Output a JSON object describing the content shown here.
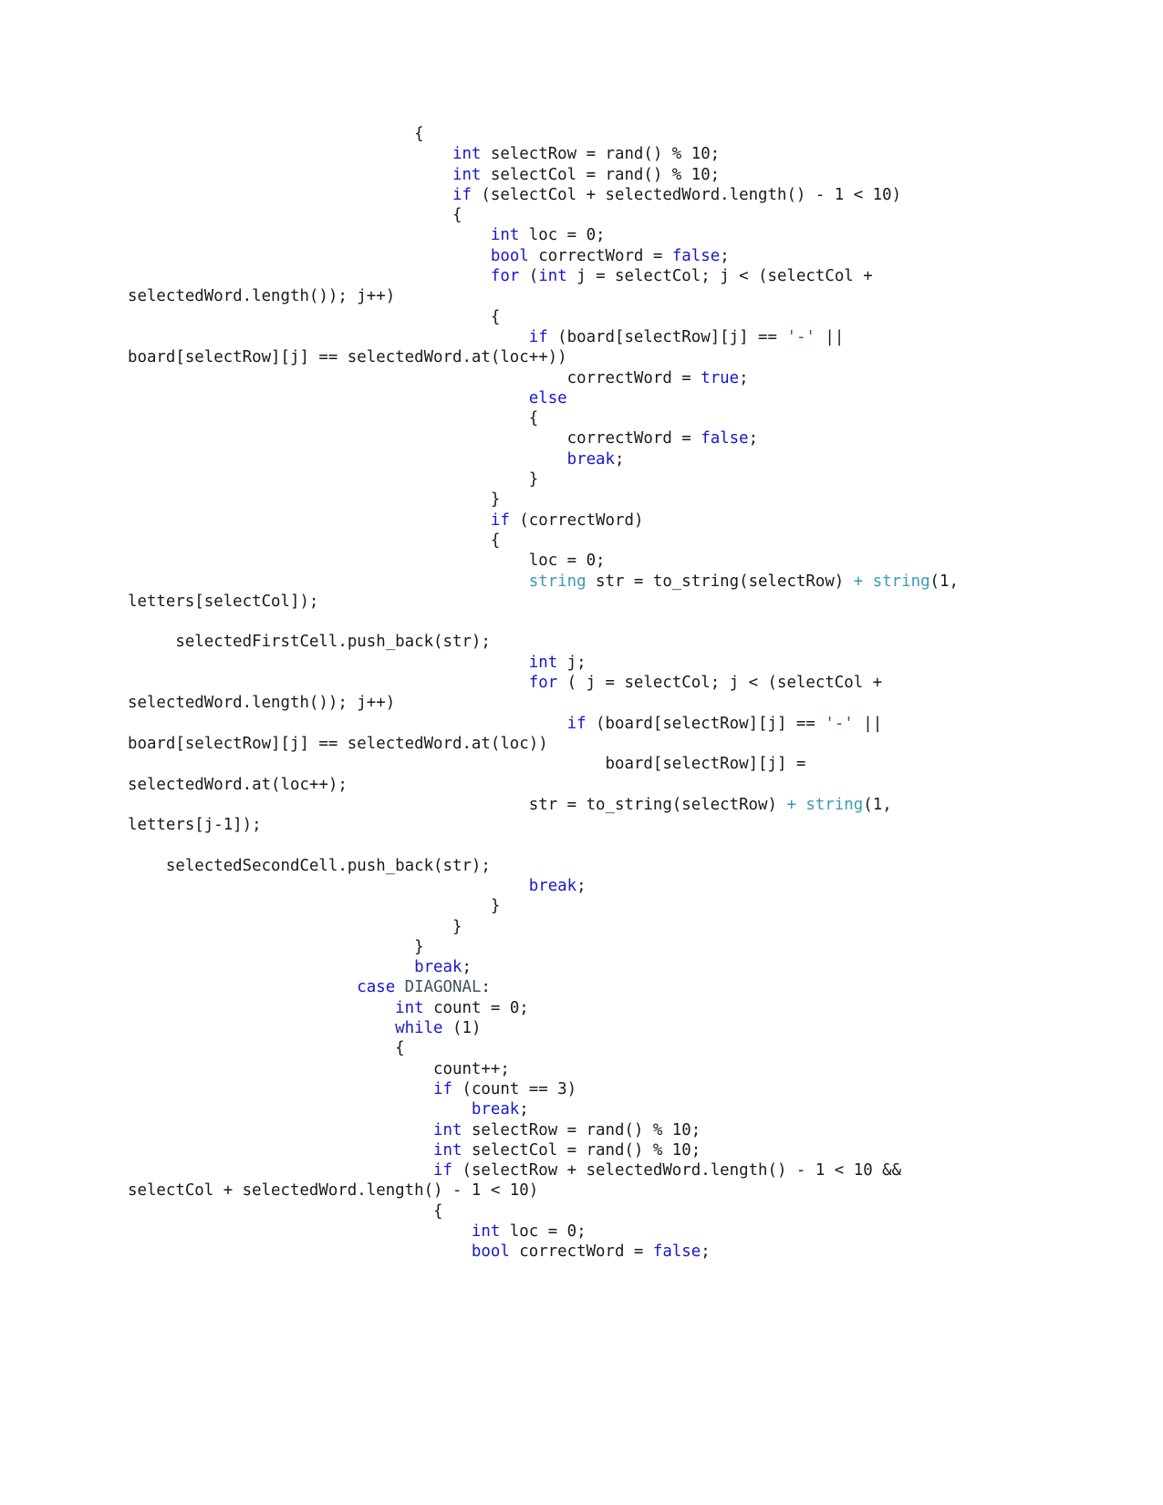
{
  "document": {
    "kind": "code-listing-page",
    "language": "C++",
    "page_background": "#ffffff",
    "text_color": "#1a1a1a",
    "colors": {
      "keyword": "#1717cf",
      "type": "#3a9ab5",
      "operator": "#2e9ab0",
      "char_literal": "#9e2b2b",
      "enum_constant": "#3f5160",
      "plain": "#1a1a1a"
    },
    "lines": [
      {
        "id": "l01",
        "segments": [
          {
            "t": "                              {",
            "c": "pl"
          }
        ]
      },
      {
        "id": "l02",
        "segments": [
          {
            "t": "                                  ",
            "c": "pl"
          },
          {
            "t": "int",
            "c": "kw"
          },
          {
            "t": " selectRow = rand() % 10;",
            "c": "pl"
          }
        ]
      },
      {
        "id": "l03",
        "segments": [
          {
            "t": "                                  ",
            "c": "pl"
          },
          {
            "t": "int",
            "c": "kw"
          },
          {
            "t": " selectCol = rand() % 10;",
            "c": "pl"
          }
        ]
      },
      {
        "id": "l04",
        "segments": [
          {
            "t": "                                  ",
            "c": "pl"
          },
          {
            "t": "if",
            "c": "kw"
          },
          {
            "t": " (selectCol + selectedWord.length() - 1 < 10)",
            "c": "pl"
          }
        ]
      },
      {
        "id": "l05",
        "segments": [
          {
            "t": "                                  {",
            "c": "pl"
          }
        ]
      },
      {
        "id": "l06",
        "segments": [
          {
            "t": "                                      ",
            "c": "pl"
          },
          {
            "t": "int",
            "c": "kw"
          },
          {
            "t": " loc = 0;",
            "c": "pl"
          }
        ]
      },
      {
        "id": "l07",
        "segments": [
          {
            "t": "                                      ",
            "c": "pl"
          },
          {
            "t": "bool",
            "c": "kw"
          },
          {
            "t": " correctWord = ",
            "c": "pl"
          },
          {
            "t": "false",
            "c": "kw"
          },
          {
            "t": ";",
            "c": "pl"
          }
        ]
      },
      {
        "id": "l08",
        "segments": [
          {
            "t": "                                      ",
            "c": "pl"
          },
          {
            "t": "for",
            "c": "kw"
          },
          {
            "t": " (",
            "c": "pl"
          },
          {
            "t": "int",
            "c": "kw"
          },
          {
            "t": " j = selectCol; j < (selectCol + selectedWord.length()); j++)",
            "c": "pl"
          }
        ]
      },
      {
        "id": "l09",
        "segments": [
          {
            "t": "                                      {",
            "c": "pl"
          }
        ]
      },
      {
        "id": "l10",
        "segments": [
          {
            "t": "                                          ",
            "c": "pl"
          },
          {
            "t": "if",
            "c": "kw"
          },
          {
            "t": " (board[selectRow][j] == ",
            "c": "pl"
          },
          {
            "t": "'-'",
            "c": "chr"
          },
          {
            "t": " || board[selectRow][j] == selectedWord.at(loc++))",
            "c": "pl"
          }
        ]
      },
      {
        "id": "l11",
        "segments": [
          {
            "t": "                                              correctWord = ",
            "c": "pl"
          },
          {
            "t": "true",
            "c": "kw"
          },
          {
            "t": ";",
            "c": "pl"
          }
        ]
      },
      {
        "id": "l12",
        "segments": [
          {
            "t": "                                          ",
            "c": "pl"
          },
          {
            "t": "else",
            "c": "kw"
          }
        ]
      },
      {
        "id": "l13",
        "segments": [
          {
            "t": "                                          {",
            "c": "pl"
          }
        ]
      },
      {
        "id": "l14",
        "segments": [
          {
            "t": "                                              correctWord = ",
            "c": "pl"
          },
          {
            "t": "false",
            "c": "kw"
          },
          {
            "t": ";",
            "c": "pl"
          }
        ]
      },
      {
        "id": "l15",
        "segments": [
          {
            "t": "                                              ",
            "c": "pl"
          },
          {
            "t": "break",
            "c": "kw"
          },
          {
            "t": ";",
            "c": "pl"
          }
        ]
      },
      {
        "id": "l16",
        "segments": [
          {
            "t": "                                          }",
            "c": "pl"
          }
        ]
      },
      {
        "id": "l17",
        "segments": [
          {
            "t": "                                      }",
            "c": "pl"
          }
        ]
      },
      {
        "id": "l18",
        "segments": [
          {
            "t": "                                      ",
            "c": "pl"
          },
          {
            "t": "if",
            "c": "kw"
          },
          {
            "t": " (correctWord)",
            "c": "pl"
          }
        ]
      },
      {
        "id": "l19",
        "segments": [
          {
            "t": "                                      {",
            "c": "pl"
          }
        ]
      },
      {
        "id": "l20",
        "segments": [
          {
            "t": "                                          loc = 0;",
            "c": "pl"
          }
        ]
      },
      {
        "id": "l21",
        "segments": [
          {
            "t": "                                          ",
            "c": "pl"
          },
          {
            "t": "string",
            "c": "type"
          },
          {
            "t": " str = to_string(selectRow) ",
            "c": "pl"
          },
          {
            "t": "+",
            "c": "op"
          },
          {
            "t": " ",
            "c": "pl"
          },
          {
            "t": "string",
            "c": "type"
          },
          {
            "t": "(1, letters[selectCol]);",
            "c": "pl"
          }
        ]
      },
      {
        "id": "l22",
        "segments": [
          {
            "t": "",
            "c": "pl"
          }
        ]
      },
      {
        "id": "l23",
        "segments": [
          {
            "t": "     selectedFirstCell.push_back(str);",
            "c": "pl"
          }
        ]
      },
      {
        "id": "l24",
        "segments": [
          {
            "t": "                                          ",
            "c": "pl"
          },
          {
            "t": "int",
            "c": "kw"
          },
          {
            "t": " j;",
            "c": "pl"
          }
        ]
      },
      {
        "id": "l25",
        "segments": [
          {
            "t": "                                          ",
            "c": "pl"
          },
          {
            "t": "for",
            "c": "kw"
          },
          {
            "t": " ( j = selectCol; j < (selectCol + selectedWord.length()); j++)",
            "c": "pl"
          }
        ]
      },
      {
        "id": "l26",
        "segments": [
          {
            "t": "                                              ",
            "c": "pl"
          },
          {
            "t": "if",
            "c": "kw"
          },
          {
            "t": " (board[selectRow][j] == ",
            "c": "pl"
          },
          {
            "t": "'-'",
            "c": "chr"
          },
          {
            "t": " || board[selectRow][j] == selectedWord.at(loc))",
            "c": "pl"
          }
        ]
      },
      {
        "id": "l27",
        "segments": [
          {
            "t": "                                                  board[selectRow][j] = selectedWord.at(loc++);",
            "c": "pl"
          }
        ]
      },
      {
        "id": "l28",
        "segments": [
          {
            "t": "                                          str = to_string(selectRow) ",
            "c": "pl"
          },
          {
            "t": "+",
            "c": "op"
          },
          {
            "t": " ",
            "c": "pl"
          },
          {
            "t": "string",
            "c": "type"
          },
          {
            "t": "(1, letters[j-1]);",
            "c": "pl"
          }
        ]
      },
      {
        "id": "l29",
        "segments": [
          {
            "t": "",
            "c": "pl"
          }
        ]
      },
      {
        "id": "l30",
        "segments": [
          {
            "t": "    selectedSecondCell.push_back(str);",
            "c": "pl"
          }
        ]
      },
      {
        "id": "l31",
        "segments": [
          {
            "t": "                                          ",
            "c": "pl"
          },
          {
            "t": "break",
            "c": "kw"
          },
          {
            "t": ";",
            "c": "pl"
          }
        ]
      },
      {
        "id": "l32",
        "segments": [
          {
            "t": "                                      }",
            "c": "pl"
          }
        ]
      },
      {
        "id": "l33",
        "segments": [
          {
            "t": "                                  }",
            "c": "pl"
          }
        ]
      },
      {
        "id": "l34",
        "segments": [
          {
            "t": "                              }",
            "c": "pl"
          }
        ]
      },
      {
        "id": "l35",
        "segments": [
          {
            "t": "                              ",
            "c": "pl"
          },
          {
            "t": "break",
            "c": "kw"
          },
          {
            "t": ";",
            "c": "pl"
          }
        ]
      },
      {
        "id": "l36",
        "segments": [
          {
            "t": "                        ",
            "c": "pl"
          },
          {
            "t": "case",
            "c": "kw"
          },
          {
            "t": " ",
            "c": "pl"
          },
          {
            "t": "DIAGONAL",
            "c": "enum"
          },
          {
            "t": ":",
            "c": "pl"
          }
        ]
      },
      {
        "id": "l37",
        "segments": [
          {
            "t": "                            ",
            "c": "pl"
          },
          {
            "t": "int",
            "c": "kw"
          },
          {
            "t": " count = 0;",
            "c": "pl"
          }
        ]
      },
      {
        "id": "l38",
        "segments": [
          {
            "t": "                            ",
            "c": "pl"
          },
          {
            "t": "while",
            "c": "kw"
          },
          {
            "t": " (1)",
            "c": "pl"
          }
        ]
      },
      {
        "id": "l39",
        "segments": [
          {
            "t": "                            {",
            "c": "pl"
          }
        ]
      },
      {
        "id": "l40",
        "segments": [
          {
            "t": "                                count++;",
            "c": "pl"
          }
        ]
      },
      {
        "id": "l41",
        "segments": [
          {
            "t": "                                ",
            "c": "pl"
          },
          {
            "t": "if",
            "c": "kw"
          },
          {
            "t": " (count == 3)",
            "c": "pl"
          }
        ]
      },
      {
        "id": "l42",
        "segments": [
          {
            "t": "                                    ",
            "c": "pl"
          },
          {
            "t": "break",
            "c": "kw"
          },
          {
            "t": ";",
            "c": "pl"
          }
        ]
      },
      {
        "id": "l43",
        "segments": [
          {
            "t": "                                ",
            "c": "pl"
          },
          {
            "t": "int",
            "c": "kw"
          },
          {
            "t": " selectRow = rand() % 10;",
            "c": "pl"
          }
        ]
      },
      {
        "id": "l44",
        "segments": [
          {
            "t": "                                ",
            "c": "pl"
          },
          {
            "t": "int",
            "c": "kw"
          },
          {
            "t": " selectCol = rand() % 10;",
            "c": "pl"
          }
        ]
      },
      {
        "id": "l45",
        "segments": [
          {
            "t": "                                ",
            "c": "pl"
          },
          {
            "t": "if",
            "c": "kw"
          },
          {
            "t": " (selectRow + selectedWord.length() - 1 < 10 && selectCol + selectedWord.length() - 1 < 10)",
            "c": "pl"
          }
        ]
      },
      {
        "id": "l46",
        "segments": [
          {
            "t": "                                {",
            "c": "pl"
          }
        ]
      },
      {
        "id": "l47",
        "segments": [
          {
            "t": "                                    ",
            "c": "pl"
          },
          {
            "t": "int",
            "c": "kw"
          },
          {
            "t": " loc = 0;",
            "c": "pl"
          }
        ]
      },
      {
        "id": "l48",
        "segments": [
          {
            "t": "                                    ",
            "c": "pl"
          },
          {
            "t": "bool",
            "c": "kw"
          },
          {
            "t": " correctWord = ",
            "c": "pl"
          },
          {
            "t": "false",
            "c": "kw"
          },
          {
            "t": ";",
            "c": "pl"
          }
        ]
      }
    ]
  }
}
